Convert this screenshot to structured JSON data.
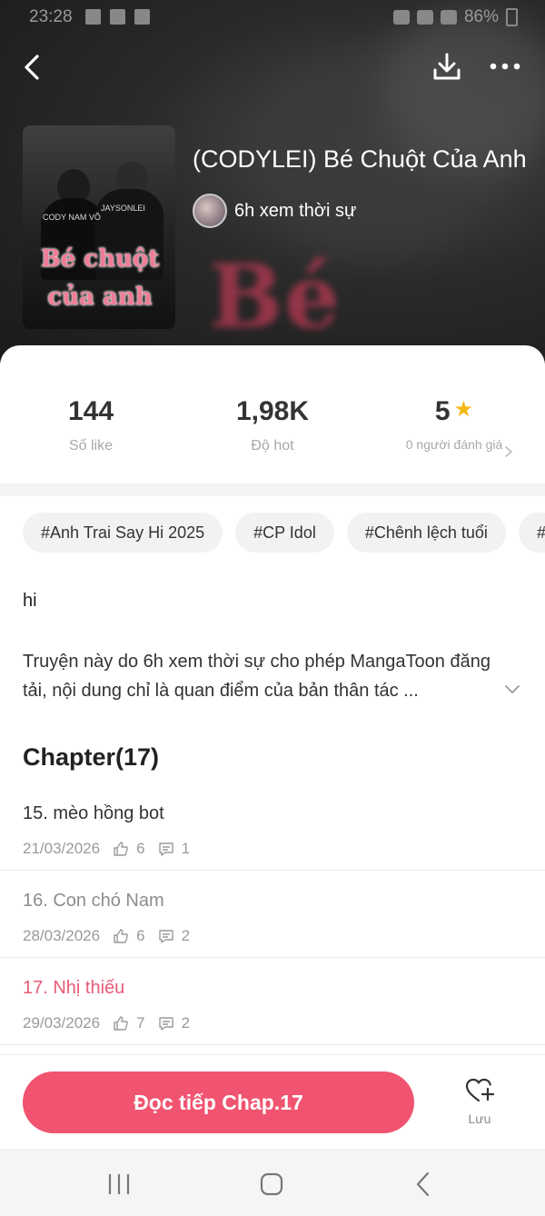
{
  "status_bar": {
    "time": "23:28",
    "battery": "86%"
  },
  "book": {
    "title": "(CODYLEI) Bé Chuột Của Anh",
    "author": "6h xem thời sự",
    "cover_text_line1": "Bé chuột",
    "cover_text_line2": "của anh",
    "cover_label_1": "CODY NAM VÕ",
    "cover_label_2": "JAYSONLEI"
  },
  "stats": [
    {
      "value": "144",
      "label": "Số like"
    },
    {
      "value": "1,98K",
      "label": "Độ hot"
    },
    {
      "value": "5",
      "label": "0 người đánh giá"
    }
  ],
  "tags": [
    "#Anh Trai Say Hi 2025",
    "#CP Idol",
    "#Chênh lệch tuổi",
    "#C"
  ],
  "description": {
    "short": "hi",
    "long": "Truyện này do 6h xem thời sự cho phép MangaToon đăng tải, nội dung chỉ là quan điểm của bản thân tác ..."
  },
  "chapter_header": "Chapter(17)",
  "chapters": [
    {
      "title": "15. mèo hồng bot",
      "date": "21/03/2026",
      "likes": "6",
      "comments": "1",
      "state": "unread"
    },
    {
      "title": "16. Con chó Nam",
      "date": "28/03/2026",
      "likes": "6",
      "comments": "2",
      "state": "read"
    },
    {
      "title": "17. Nhị thiếu",
      "date": "29/03/2026",
      "likes": "7",
      "comments": "2",
      "state": "current"
    }
  ],
  "actions": {
    "continue_label": "Đọc tiếp Chap.17",
    "save_label": "Lưu"
  },
  "colors": {
    "accent": "#f05470",
    "current_chapter": "#e85a76",
    "star": "#f3b814"
  },
  "icons": [
    "back-arrow-icon",
    "download-icon",
    "more-dots-icon",
    "star-icon",
    "chevron-right-icon",
    "chevron-down-icon",
    "thumbs-up-icon",
    "comment-icon",
    "heart-plus-icon"
  ]
}
